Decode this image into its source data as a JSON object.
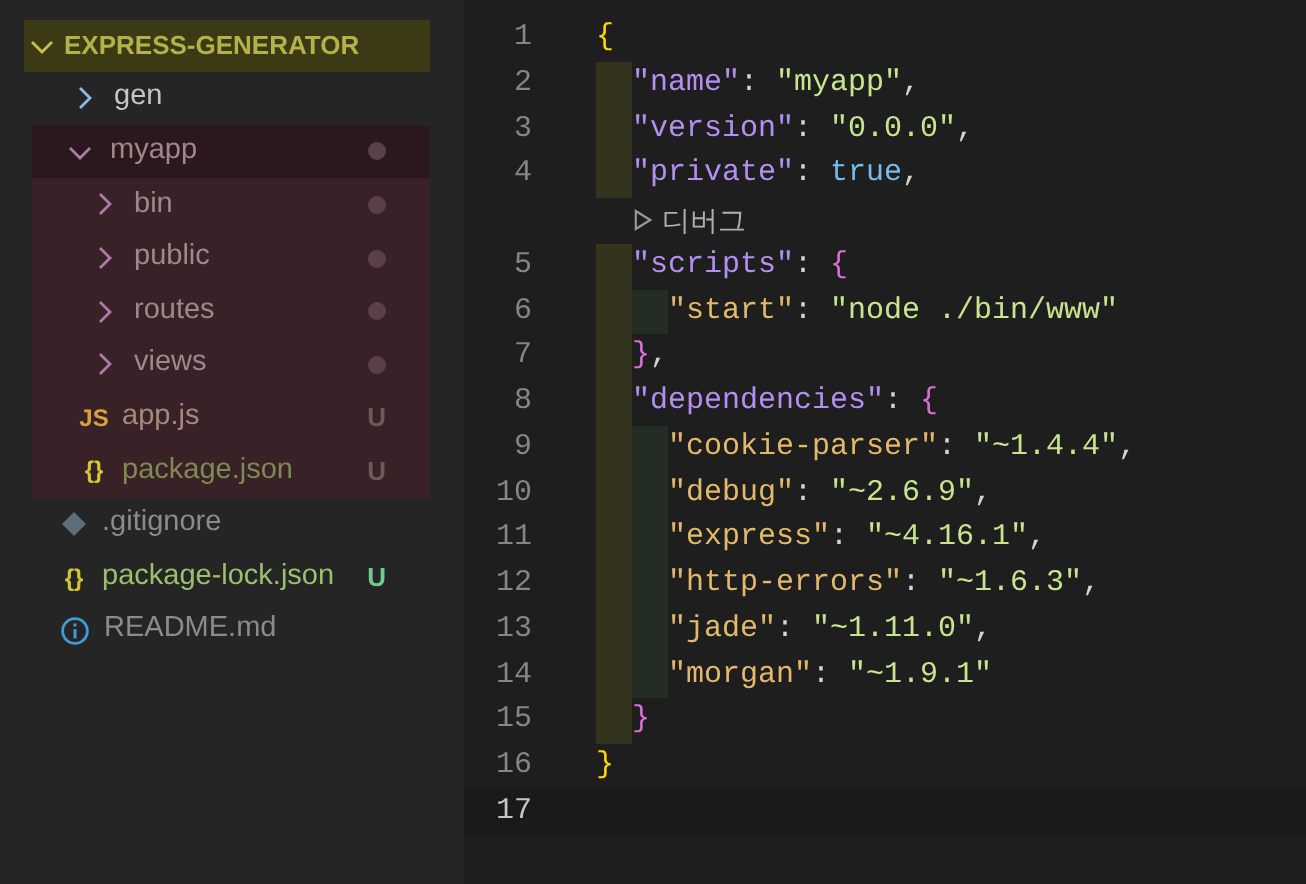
{
  "explorer": {
    "root": {
      "label": "EXPRESS-GENERATOR",
      "expanded": true
    },
    "tree": [
      {
        "label": "gen",
        "kind": "folder",
        "expanded": false
      },
      {
        "label": "myapp",
        "kind": "folder",
        "expanded": true,
        "highlighted": true,
        "dot": true,
        "children": [
          {
            "label": "bin",
            "kind": "folder",
            "expanded": false,
            "dot": true
          },
          {
            "label": "public",
            "kind": "folder",
            "expanded": false,
            "dot": true
          },
          {
            "label": "routes",
            "kind": "folder",
            "expanded": false,
            "dot": true
          },
          {
            "label": "views",
            "kind": "folder",
            "expanded": false,
            "dot": true
          },
          {
            "label": "app.js",
            "kind": "js_file",
            "icon_text": "JS",
            "badge": "U"
          },
          {
            "label": "package.json",
            "kind": "json_file",
            "icon_text": "{}",
            "badge": "U"
          }
        ]
      },
      {
        "label": ".gitignore",
        "kind": "git_file"
      },
      {
        "label": "package-lock.json",
        "kind": "json_file",
        "icon_text": "{}",
        "badge": "U"
      },
      {
        "label": "README.md",
        "kind": "info_file"
      }
    ]
  },
  "editor": {
    "lines": [
      {
        "number": "1",
        "tokens": [
          {
            "text": "{",
            "kind": "brace_outer"
          }
        ]
      },
      {
        "number": "2",
        "tokens": [
          {
            "text": "  \"name\"",
            "kind": "key_top"
          },
          {
            "text": ":",
            "kind": "punct"
          },
          {
            "text": " \"myapp\"",
            "kind": "string"
          },
          {
            "text": ",",
            "kind": "punct"
          }
        ]
      },
      {
        "number": "3",
        "tokens": [
          {
            "text": "  \"version\"",
            "kind": "key_top"
          },
          {
            "text": ":",
            "kind": "punct"
          },
          {
            "text": " \"0.0.0\"",
            "kind": "string"
          },
          {
            "text": ",",
            "kind": "punct"
          }
        ]
      },
      {
        "number": "4",
        "tokens": [
          {
            "text": "  \"private\"",
            "kind": "key_top"
          },
          {
            "text": ":",
            "kind": "punct"
          },
          {
            "text": " true",
            "kind": "boolean"
          },
          {
            "text": ",",
            "kind": "punct"
          }
        ]
      },
      {
        "kind": "lens",
        "label": "디버그"
      },
      {
        "number": "5",
        "tokens": [
          {
            "text": "  \"scripts\"",
            "kind": "key_top"
          },
          {
            "text": ":",
            "kind": "punct"
          },
          {
            "text": " {",
            "kind": "brace_inner"
          }
        ]
      },
      {
        "number": "6",
        "tokens": [
          {
            "text": "    \"start\"",
            "kind": "key_nested"
          },
          {
            "text": ":",
            "kind": "punct"
          },
          {
            "text": " \"node ./bin/www\"",
            "kind": "string"
          }
        ]
      },
      {
        "number": "7",
        "tokens": [
          {
            "text": "  }",
            "kind": "brace_inner"
          },
          {
            "text": ",",
            "kind": "punct"
          }
        ]
      },
      {
        "number": "8",
        "tokens": [
          {
            "text": "  \"dependencies\"",
            "kind": "key_top"
          },
          {
            "text": ":",
            "kind": "punct"
          },
          {
            "text": " {",
            "kind": "brace_inner"
          }
        ]
      },
      {
        "number": "9",
        "tokens": [
          {
            "text": "    \"cookie-parser\"",
            "kind": "key_nested"
          },
          {
            "text": ":",
            "kind": "punct"
          },
          {
            "text": " \"~1.4.4\"",
            "kind": "string"
          },
          {
            "text": ",",
            "kind": "punct"
          }
        ]
      },
      {
        "number": "10",
        "tokens": [
          {
            "text": "    \"debug\"",
            "kind": "key_nested"
          },
          {
            "text": ":",
            "kind": "punct"
          },
          {
            "text": " \"~2.6.9\"",
            "kind": "string"
          },
          {
            "text": ",",
            "kind": "punct"
          }
        ]
      },
      {
        "number": "11",
        "tokens": [
          {
            "text": "    \"express\"",
            "kind": "key_nested"
          },
          {
            "text": ":",
            "kind": "punct"
          },
          {
            "text": " \"~4.16.1\"",
            "kind": "string"
          },
          {
            "text": ",",
            "kind": "punct"
          }
        ]
      },
      {
        "number": "12",
        "tokens": [
          {
            "text": "    \"http-errors\"",
            "kind": "key_nested"
          },
          {
            "text": ":",
            "kind": "punct"
          },
          {
            "text": " \"~1.6.3\"",
            "kind": "string"
          },
          {
            "text": ",",
            "kind": "punct"
          }
        ]
      },
      {
        "number": "13",
        "tokens": [
          {
            "text": "    \"jade\"",
            "kind": "key_nested"
          },
          {
            "text": ":",
            "kind": "punct"
          },
          {
            "text": " \"~1.11.0\"",
            "kind": "string"
          },
          {
            "text": ",",
            "kind": "punct"
          }
        ]
      },
      {
        "number": "14",
        "tokens": [
          {
            "text": "    \"morgan\"",
            "kind": "key_nested"
          },
          {
            "text": ":",
            "kind": "punct"
          },
          {
            "text": " \"~1.9.1\"",
            "kind": "string"
          }
        ]
      },
      {
        "number": "15",
        "tokens": [
          {
            "text": "  }",
            "kind": "brace_inner"
          }
        ]
      },
      {
        "number": "16",
        "tokens": [
          {
            "text": "}",
            "kind": "brace_outer"
          }
        ]
      },
      {
        "number": "17",
        "current": true
      }
    ]
  }
}
